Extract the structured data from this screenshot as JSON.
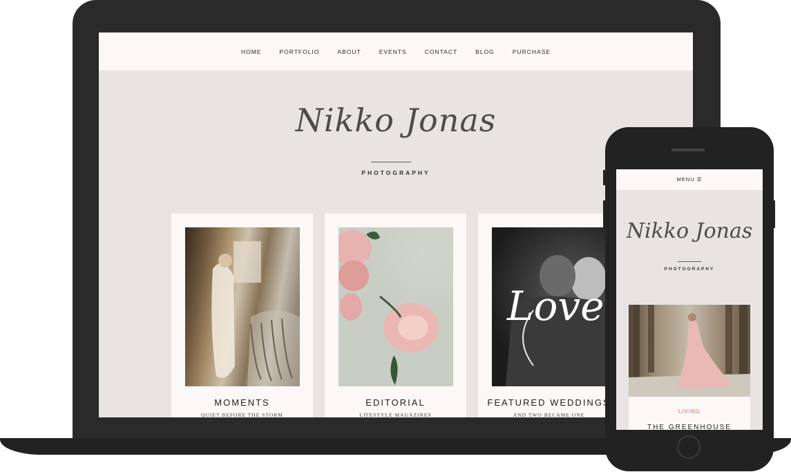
{
  "desktop": {
    "nav": [
      "HOME",
      "PORTFOLIO",
      "ABOUT",
      "EVENTS",
      "CONTACT",
      "BLOG",
      "PURCHASE"
    ],
    "logo": {
      "script": "Nikko Jonas",
      "subtitle": "PHOTOGRAPHY"
    },
    "cards": [
      {
        "title": "MOMENTS",
        "subtitle": "QUIET BEFORE THE STORM"
      },
      {
        "title": "EDITORIAL",
        "subtitle": "LIFESTYLE MAGAZINES"
      },
      {
        "title": "FEATURED WEDDINGS",
        "subtitle": "AND TWO BECAME ONE",
        "overlay": "Love"
      }
    ]
  },
  "mobile": {
    "menu_label": "MENU ☰",
    "logo": {
      "script": "Nikko Jonas",
      "subtitle": "PHOTOGRAPHY"
    },
    "card": {
      "category": "LIVING",
      "title": "THE GREENHOUSE"
    }
  },
  "colors": {
    "device": "#2a2a2a",
    "screen_bg": "#e8e4e4",
    "card_bg": "#fbf8f7",
    "accent": "#d46a5a"
  }
}
